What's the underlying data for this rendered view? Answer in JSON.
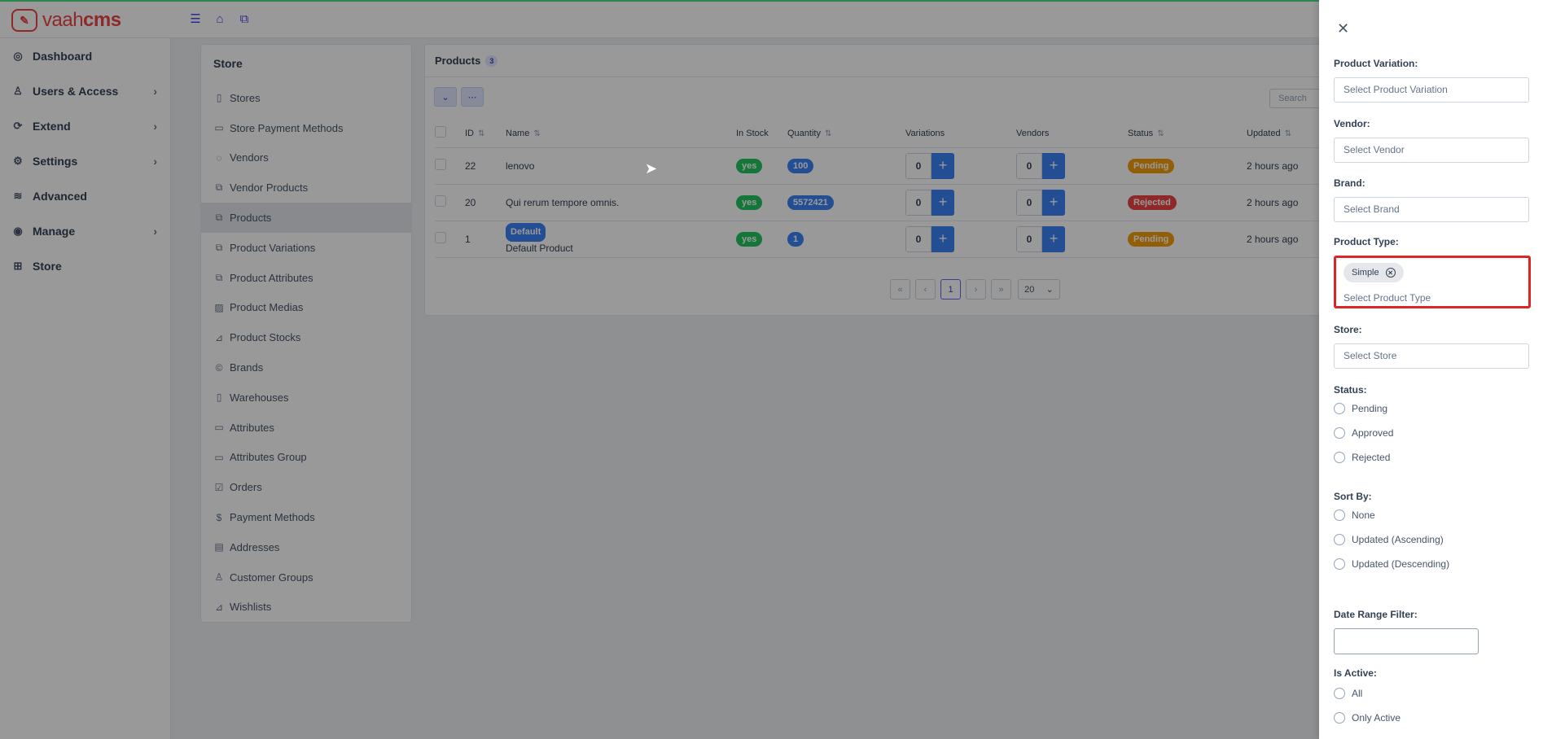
{
  "brand": {
    "logo_glyph": "✎",
    "name_light": "vaah",
    "name_bold": "cms"
  },
  "top_icons": [
    "menu-icon",
    "home-icon",
    "external-link-icon"
  ],
  "sidebar": {
    "items": [
      {
        "label": "Dashboard",
        "icon": "dashboard-icon",
        "glyph": "◎",
        "has_children": false
      },
      {
        "label": "Users & Access",
        "icon": "user-icon",
        "glyph": "♙",
        "has_children": true
      },
      {
        "label": "Extend",
        "icon": "extend-icon",
        "glyph": "⟳",
        "has_children": true
      },
      {
        "label": "Settings",
        "icon": "gear-icon",
        "glyph": "⚙",
        "has_children": true
      },
      {
        "label": "Advanced",
        "icon": "database-icon",
        "glyph": "≋",
        "has_children": false
      },
      {
        "label": "Manage",
        "icon": "manage-icon",
        "glyph": "◉",
        "has_children": true
      },
      {
        "label": "Store",
        "icon": "store-grid-icon",
        "glyph": "⊞",
        "has_children": false
      }
    ]
  },
  "submenu": {
    "title": "Store",
    "items": [
      {
        "label": "Stores",
        "glyph": "▯"
      },
      {
        "label": "Store Payment Methods",
        "glyph": "▭"
      },
      {
        "label": "Vendors",
        "glyph": "◌"
      },
      {
        "label": "Vendor Products",
        "glyph": "⧉"
      },
      {
        "label": "Products",
        "glyph": "⧉",
        "active": true
      },
      {
        "label": "Product Variations",
        "glyph": "⧉"
      },
      {
        "label": "Product Attributes",
        "glyph": "⧉"
      },
      {
        "label": "Product Medias",
        "glyph": "▨"
      },
      {
        "label": "Product Stocks",
        "glyph": "⊿"
      },
      {
        "label": "Brands",
        "glyph": "©"
      },
      {
        "label": "Warehouses",
        "glyph": "▯"
      },
      {
        "label": "Attributes",
        "glyph": "▭"
      },
      {
        "label": "Attributes Group",
        "glyph": "▭"
      },
      {
        "label": "Orders",
        "glyph": "☑"
      },
      {
        "label": "Payment Methods",
        "glyph": "$"
      },
      {
        "label": "Addresses",
        "glyph": "▤"
      },
      {
        "label": "Customer Groups",
        "glyph": "♙"
      },
      {
        "label": "Wishlists",
        "glyph": "⊿"
      }
    ]
  },
  "products": {
    "title": "Products",
    "count": "3",
    "search_placeholder": "Search",
    "columns": {
      "id": "ID",
      "name": "Name",
      "in_stock": "In Stock",
      "quantity": "Quantity",
      "variations": "Variations",
      "vendors": "Vendors",
      "status": "Status",
      "updated": "Updated"
    },
    "rows": [
      {
        "id": "22",
        "name": "lenovo",
        "default": false,
        "in_stock": "yes",
        "quantity": "100",
        "variations": "0",
        "vendors": "0",
        "status": "Pending",
        "status_color": "#f59e0b",
        "updated": "2 hours ago"
      },
      {
        "id": "20",
        "name": "Qui rerum tempore omnis.",
        "default": false,
        "in_stock": "yes",
        "quantity": "5572421",
        "variations": "0",
        "vendors": "0",
        "status": "Rejected",
        "status_color": "#ef4444",
        "updated": "2 hours ago"
      },
      {
        "id": "1",
        "name": "Default Product",
        "default": true,
        "default_label": "Default",
        "in_stock": "yes",
        "quantity": "1",
        "variations": "0",
        "vendors": "0",
        "status": "Pending",
        "status_color": "#f59e0b",
        "updated": "2 hours ago"
      }
    ],
    "pagination": {
      "first": "«",
      "prev": "‹",
      "current": "1",
      "next": "›",
      "last": "»",
      "per_page": "20"
    }
  },
  "filter_drawer": {
    "product_variation": {
      "label": "Product Variation:",
      "placeholder": "Select Product Variation"
    },
    "vendor": {
      "label": "Vendor:",
      "placeholder": "Select Vendor"
    },
    "brand": {
      "label": "Brand:",
      "placeholder": "Select Brand"
    },
    "product_type": {
      "label": "Product Type:",
      "selected_chip": "Simple",
      "placeholder": "Select Product Type"
    },
    "store": {
      "label": "Store:",
      "placeholder": "Select Store"
    },
    "status": {
      "label": "Status:",
      "options": [
        "Pending",
        "Approved",
        "Rejected"
      ]
    },
    "sort_by": {
      "label": "Sort By:",
      "options": [
        "None",
        "Updated (Ascending)",
        "Updated (Descending)"
      ]
    },
    "date_range": {
      "label": "Date Range Filter:",
      "value": ""
    },
    "is_active": {
      "label": "Is Active:",
      "options": [
        "All",
        "Only Active"
      ]
    }
  }
}
